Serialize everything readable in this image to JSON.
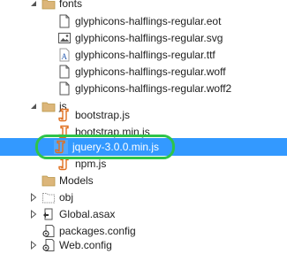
{
  "solution_explorer": {
    "items": [
      {
        "label": "fonts",
        "icon": "folder-open-icon"
      },
      {
        "label": "glyphicons-halflings-regular.eot",
        "icon": "file-icon"
      },
      {
        "label": "glyphicons-halflings-regular.svg",
        "icon": "image-file-icon"
      },
      {
        "label": "glyphicons-halflings-regular.ttf",
        "icon": "font-file-icon"
      },
      {
        "label": "glyphicons-halflings-regular.woff",
        "icon": "file-icon"
      },
      {
        "label": "glyphicons-halflings-regular.woff2",
        "icon": "file-icon"
      },
      {
        "label": "js",
        "icon": "folder-open-icon"
      },
      {
        "label": "bootstrap.js",
        "icon": "js-file-icon"
      },
      {
        "label": "bootstrap.min.js",
        "icon": "js-file-icon"
      },
      {
        "label": "jquery-3.0.0.min.js",
        "icon": "js-file-icon",
        "selected": true
      },
      {
        "label": "npm.js",
        "icon": "js-file-icon"
      },
      {
        "label": "Models",
        "icon": "folder-icon"
      },
      {
        "label": "obj",
        "icon": "folder-outline-icon"
      },
      {
        "label": "Global.asax",
        "icon": "asax-file-icon"
      },
      {
        "label": "packages.config",
        "icon": "config-file-icon"
      },
      {
        "label": "Web.config",
        "icon": "config-file-icon"
      }
    ]
  },
  "colors": {
    "selection": "#3399ff",
    "highlight_ring": "#2ec44a",
    "folder": "#dcb67a",
    "js_icon": "#e07020"
  }
}
